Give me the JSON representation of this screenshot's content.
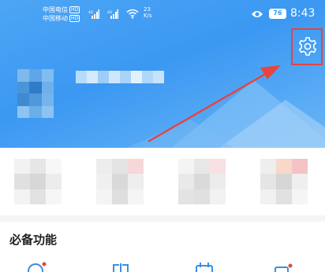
{
  "status_bar": {
    "carrier_1": "中国电信",
    "carrier_2": "中国移动",
    "hd_badge": "HD",
    "speed_value": "23",
    "speed_unit": "K/s",
    "battery": "76",
    "time": "8:43"
  },
  "section": {
    "title": "必备功能"
  },
  "colors": {
    "header_blue": "#3b98f2",
    "annotation_red": "#e8433f"
  },
  "icons": {
    "settings": "gear-icon",
    "eye": "eye-icon",
    "wifi": "wifi-icon",
    "signal": "signal-icon"
  }
}
